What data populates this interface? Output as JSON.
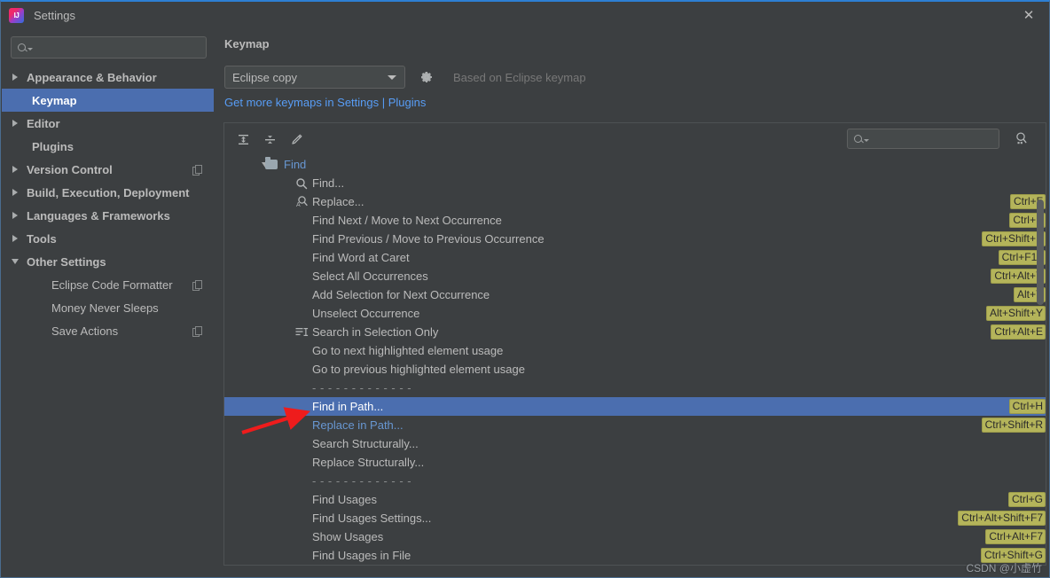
{
  "window": {
    "title": "Settings",
    "logo_icon": "intellij-idea-logo",
    "close_icon": "close-icon"
  },
  "sidebar": {
    "search_placeholder": "",
    "search_icon": "search-icon",
    "items": [
      {
        "label": "Appearance & Behavior",
        "expandable": true,
        "expanded": false,
        "selected": false,
        "indent": false,
        "bold": true,
        "copy_icon": false
      },
      {
        "label": "Keymap",
        "expandable": false,
        "expanded": false,
        "selected": true,
        "indent": false,
        "bold": true,
        "copy_icon": false
      },
      {
        "label": "Editor",
        "expandable": true,
        "expanded": false,
        "selected": false,
        "indent": false,
        "bold": true,
        "copy_icon": false
      },
      {
        "label": "Plugins",
        "expandable": false,
        "expanded": false,
        "selected": false,
        "indent": false,
        "bold": true,
        "copy_icon": false
      },
      {
        "label": "Version Control",
        "expandable": true,
        "expanded": false,
        "selected": false,
        "indent": false,
        "bold": true,
        "copy_icon": true
      },
      {
        "label": "Build, Execution, Deployment",
        "expandable": true,
        "expanded": false,
        "selected": false,
        "indent": false,
        "bold": true,
        "copy_icon": false
      },
      {
        "label": "Languages & Frameworks",
        "expandable": true,
        "expanded": false,
        "selected": false,
        "indent": false,
        "bold": true,
        "copy_icon": false
      },
      {
        "label": "Tools",
        "expandable": true,
        "expanded": false,
        "selected": false,
        "indent": false,
        "bold": true,
        "copy_icon": false
      },
      {
        "label": "Other Settings",
        "expandable": true,
        "expanded": true,
        "selected": false,
        "indent": false,
        "bold": true,
        "copy_icon": false
      },
      {
        "label": "Eclipse Code Formatter",
        "expandable": false,
        "expanded": false,
        "selected": false,
        "indent": true,
        "bold": false,
        "copy_icon": true
      },
      {
        "label": "Money Never Sleeps",
        "expandable": false,
        "expanded": false,
        "selected": false,
        "indent": true,
        "bold": false,
        "copy_icon": false
      },
      {
        "label": "Save Actions",
        "expandable": false,
        "expanded": false,
        "selected": false,
        "indent": true,
        "bold": false,
        "copy_icon": true
      }
    ]
  },
  "content": {
    "title": "Keymap",
    "keymap_select_value": "Eclipse copy",
    "gear_icon": "gear-icon",
    "based_on_text": "Based on Eclipse keymap",
    "plugins_link": "Get more keymaps in Settings | Plugins"
  },
  "toolbar": {
    "expand_all_icon": "expand-all-icon",
    "collapse_all_icon": "collapse-all-icon",
    "edit_shortcut_icon": "edit-pencil-icon",
    "search_placeholder": "",
    "search_icon": "search-icon",
    "find_by_shortcut_icon": "find-by-shortcut-icon"
  },
  "tree": {
    "rows": [
      {
        "type": "group",
        "label": "Find",
        "icon": "folder-icon",
        "expanded": true,
        "shortcut": "",
        "selected": false,
        "blue": true
      },
      {
        "type": "item",
        "label": "Find...",
        "icon": "search-icon",
        "shortcut": "",
        "selected": false,
        "blue": false
      },
      {
        "type": "item",
        "label": "Replace...",
        "icon": "replace-icon",
        "shortcut": "Ctrl+F",
        "selected": false,
        "blue": false
      },
      {
        "type": "item",
        "label": "Find Next / Move to Next Occurrence",
        "icon": "",
        "shortcut": "Ctrl+K",
        "selected": false,
        "blue": false
      },
      {
        "type": "item",
        "label": "Find Previous / Move to Previous Occurrence",
        "icon": "",
        "shortcut": "Ctrl+Shift+K",
        "selected": false,
        "blue": false
      },
      {
        "type": "item",
        "label": "Find Word at Caret",
        "icon": "",
        "shortcut": "Ctrl+F12",
        "selected": false,
        "blue": false
      },
      {
        "type": "item",
        "label": "Select All Occurrences",
        "icon": "",
        "shortcut": "Ctrl+Alt+Y",
        "selected": false,
        "blue": false
      },
      {
        "type": "item",
        "label": "Add Selection for Next Occurrence",
        "icon": "",
        "shortcut": "Alt+Y",
        "selected": false,
        "blue": false
      },
      {
        "type": "item",
        "label": "Unselect Occurrence",
        "icon": "",
        "shortcut": "Alt+Shift+Y",
        "selected": false,
        "blue": false
      },
      {
        "type": "item",
        "label": "Search in Selection Only",
        "icon": "search-in-selection-icon",
        "shortcut": "Ctrl+Alt+E",
        "selected": false,
        "blue": false
      },
      {
        "type": "item",
        "label": "Go to next highlighted element usage",
        "icon": "",
        "shortcut": "",
        "selected": false,
        "blue": false
      },
      {
        "type": "item",
        "label": "Go to previous highlighted element usage",
        "icon": "",
        "shortcut": "",
        "selected": false,
        "blue": false
      },
      {
        "type": "sep",
        "label": "- - - - - - - - - - - - -",
        "icon": "",
        "shortcut": "",
        "selected": false,
        "blue": false
      },
      {
        "type": "item",
        "label": "Find in Path...",
        "icon": "",
        "shortcut": "Ctrl+H",
        "selected": true,
        "blue": false
      },
      {
        "type": "item",
        "label": "Replace in Path...",
        "icon": "",
        "shortcut": "Ctrl+Shift+R",
        "selected": false,
        "blue": true
      },
      {
        "type": "item",
        "label": "Search Structurally...",
        "icon": "",
        "shortcut": "",
        "selected": false,
        "blue": false
      },
      {
        "type": "item",
        "label": "Replace Structurally...",
        "icon": "",
        "shortcut": "",
        "selected": false,
        "blue": false
      },
      {
        "type": "sep",
        "label": "- - - - - - - - - - - - -",
        "icon": "",
        "shortcut": "",
        "selected": false,
        "blue": false
      },
      {
        "type": "item",
        "label": "Find Usages",
        "icon": "",
        "shortcut": "Ctrl+G",
        "selected": false,
        "blue": false
      },
      {
        "type": "item",
        "label": "Find Usages Settings...",
        "icon": "",
        "shortcut": "Ctrl+Alt+Shift+F7",
        "selected": false,
        "blue": false
      },
      {
        "type": "item",
        "label": "Show Usages",
        "icon": "",
        "shortcut": "Ctrl+Alt+F7",
        "selected": false,
        "blue": false
      },
      {
        "type": "item",
        "label": "Find Usages in File",
        "icon": "",
        "shortcut": "Ctrl+Shift+G",
        "selected": false,
        "blue": false
      }
    ]
  },
  "annotation": {
    "arrow_color": "#ee1c1c",
    "watermark": "CSDN @小虚竹"
  },
  "colors": {
    "selection_blue": "#4b6eaf",
    "link_blue": "#589df6",
    "shortcut_badge": "#b4b45a",
    "panel_bg": "#3c3f41"
  }
}
